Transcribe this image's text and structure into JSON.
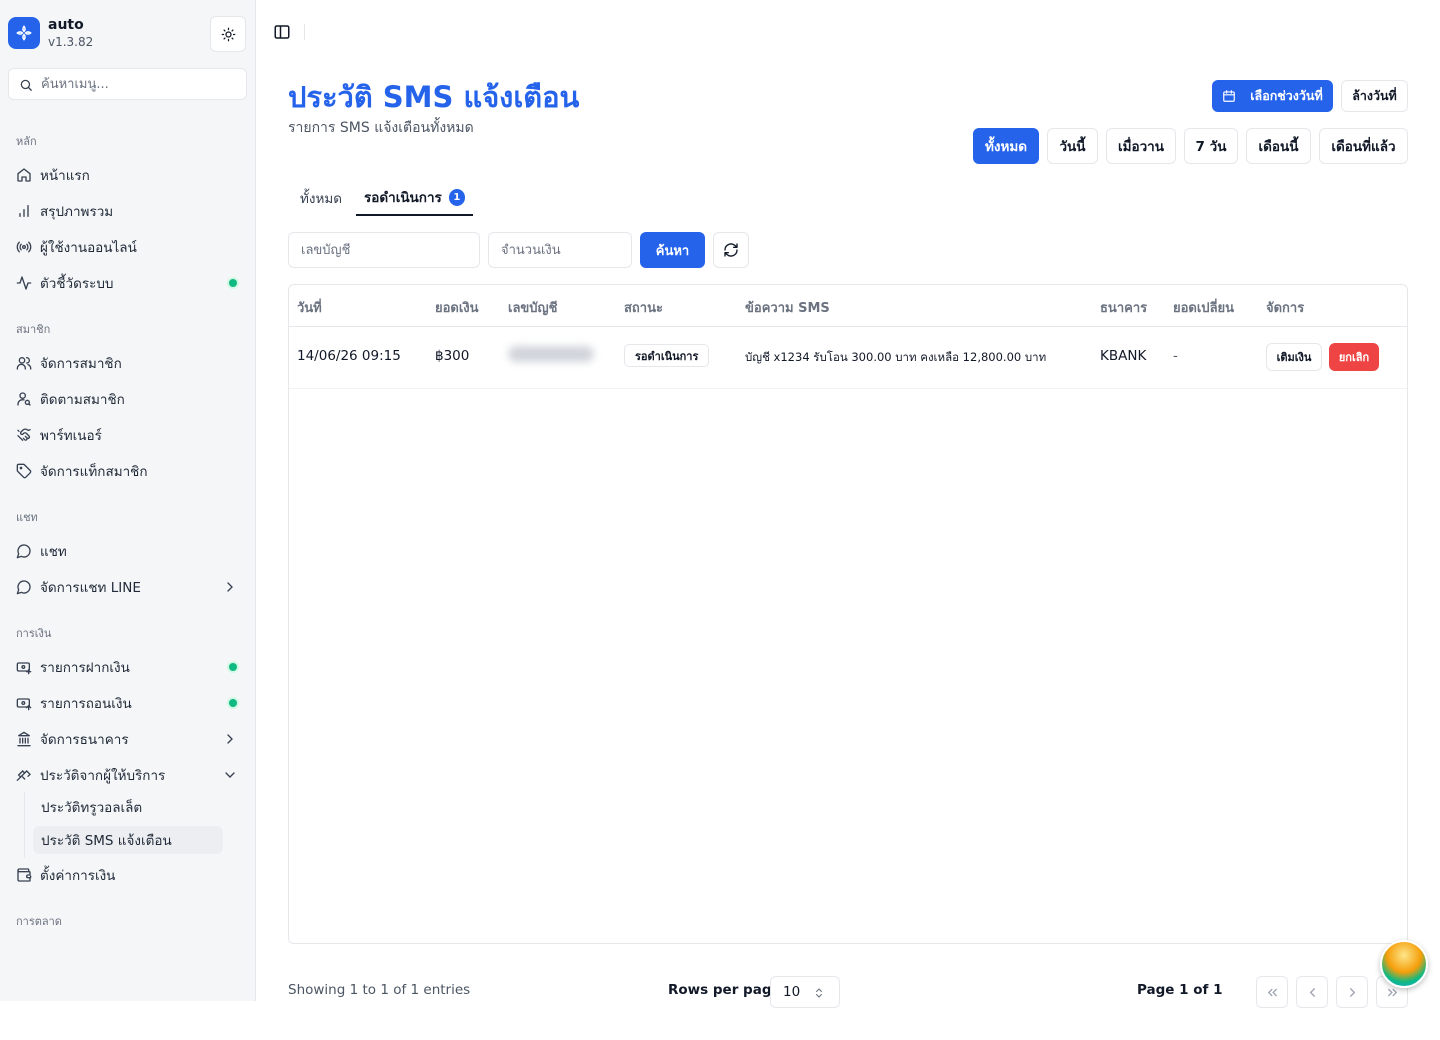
{
  "app": {
    "name": "auto",
    "version": "v1.3.82"
  },
  "sidebar": {
    "search_placeholder": "ค้นหาเมนู...",
    "groups": [
      {
        "label": "หลัก",
        "items": [
          {
            "label": "หน้าแรก",
            "icon": "home-icon"
          },
          {
            "label": "สรุปภาพรวม",
            "icon": "bar-chart-icon"
          },
          {
            "label": "ผู้ใช้งานออนไลน์",
            "icon": "broadcast-icon"
          },
          {
            "label": "ตัวชี้วัดระบบ",
            "icon": "activity-icon",
            "status_dot": true
          }
        ]
      },
      {
        "label": "สมาชิก",
        "items": [
          {
            "label": "จัดการสมาชิก",
            "icon": "users-icon"
          },
          {
            "label": "ติดตามสมาชิก",
            "icon": "user-search-icon"
          },
          {
            "label": "พาร์ทเนอร์",
            "icon": "handshake-icon"
          },
          {
            "label": "จัดการแท็กสมาชิก",
            "icon": "tag-icon"
          }
        ]
      },
      {
        "label": "แชท",
        "items": [
          {
            "label": "แชท",
            "icon": "chat-icon"
          },
          {
            "label": "จัดการแชท LINE",
            "icon": "chat-icon",
            "chevron": "right"
          }
        ]
      },
      {
        "label": "การเงิน",
        "items": [
          {
            "label": "รายการฝากเงิน",
            "icon": "deposit-icon",
            "status_dot": true
          },
          {
            "label": "รายการถอนเงิน",
            "icon": "withdraw-icon",
            "status_dot": true
          },
          {
            "label": "จัดการธนาคาร",
            "icon": "bank-icon",
            "chevron": "right"
          },
          {
            "label": "ประวัติจากผู้ให้บริการ",
            "icon": "provider-history-icon",
            "chevron": "down",
            "subitems": [
              {
                "label": "ประวัติทรูวอลเล็ต",
                "active": false
              },
              {
                "label": "ประวัติ SMS แจ้งเตือน",
                "active": true
              }
            ]
          },
          {
            "label": "ตั้งค่าการเงิน",
            "icon": "wallet-icon"
          }
        ]
      },
      {
        "label": "การตลาด",
        "items": []
      }
    ]
  },
  "header": {
    "title": "ประวัติ SMS แจ้งเตือน",
    "subtitle": "รายการ SMS แจ้งเตือนทั้งหมด",
    "date_range_button": "เลือกช่วงวันที่",
    "clear_date_button": "ล้างวันที่",
    "quick_filters": [
      {
        "label": "ทั้งหมด",
        "active": true
      },
      {
        "label": "วันนี้",
        "active": false
      },
      {
        "label": "เมื่อวาน",
        "active": false
      },
      {
        "label": "7 วัน",
        "active": false
      },
      {
        "label": "เดือนนี้",
        "active": false
      },
      {
        "label": "เดือนที่แล้ว",
        "active": false
      }
    ]
  },
  "tabs": [
    {
      "label": "ทั้งหมด",
      "active": false
    },
    {
      "label": "รอดำเนินการ",
      "active": true,
      "badge": "1"
    }
  ],
  "filters": {
    "account_placeholder": "เลขบัญชี",
    "amount_placeholder": "จำนวนเงิน",
    "search_button": "ค้นหา"
  },
  "table": {
    "columns": [
      "วันที่",
      "ยอดเงิน",
      "เลขบัญชี",
      "สถานะ",
      "ข้อความ SMS",
      "ธนาคาร",
      "ยอดเปลี่ยน",
      "จัดการ"
    ],
    "rows": [
      {
        "date": "14/06/26 09:15",
        "amount": "฿300",
        "account": "",
        "status": "รอดำเนินการ",
        "sms": "บัญชี x1234 รับโอน 300.00 บาท คงเหลือ 12,800.00 บาท",
        "bank": "KBANK",
        "change": "-",
        "actions": {
          "topup": "เติมเงิน",
          "cancel": "ยกเลิก"
        }
      }
    ]
  },
  "footer": {
    "showing": "Showing 1 to 1 of 1 entries",
    "rows_per_page_label": "Rows per page",
    "rows_per_page_value": "10",
    "page_info": "Page 1 of 1"
  },
  "colors": {
    "accent": "#2563eb",
    "danger": "#ef4444",
    "status_dot": "#10b981"
  }
}
